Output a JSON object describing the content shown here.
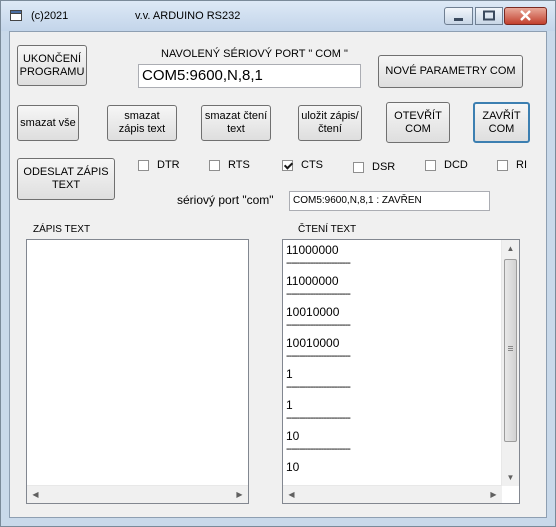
{
  "window": {
    "title_left": "(c)2021",
    "title_right": "v.v.   ARDUINO  RS232",
    "icons": {
      "app": "window-app-icon",
      "minimize": "minimize-icon",
      "maximize": "maximize-icon",
      "close": "close-icon"
    }
  },
  "buttons": {
    "end_program": "UKONČENÍ PROGRAMU",
    "new_params": "NOVÉ PARAMETRY COM",
    "clear_all": "smazat vše",
    "clear_write": "smazat zápis text",
    "clear_read": "smazat čtení text",
    "save": "uložit zápis/čtení",
    "open_com": "OTEVŘÍT COM",
    "close_com": "ZAVŘÍT COM",
    "send_text": "ODESLAT ZÁPIS TEXT"
  },
  "port_section": {
    "heading": "NAVOLENÝ SÉRIOVÝ PORT \" COM \"",
    "value": "COM5:9600,N,8,1"
  },
  "signals": [
    {
      "label": "DTR",
      "checked": false
    },
    {
      "label": "RTS",
      "checked": false
    },
    {
      "label": "CTS",
      "checked": true
    },
    {
      "label": "DSR",
      "checked": false
    },
    {
      "label": "DCD",
      "checked": false
    },
    {
      "label": "RI",
      "checked": false
    }
  ],
  "status": {
    "label": "sériový port \"com\"",
    "value": "COM5:9600,N,8,1 : ZAVŘEN"
  },
  "write_panel": {
    "label": "ZÁPIS TEXT",
    "lines": []
  },
  "read_panel": {
    "label": "ČTENÍ TEXT",
    "separator": "------------------------",
    "lines": [
      "11000000",
      "11000000",
      "10010000",
      "10010000",
      "1",
      "1",
      "10",
      "10"
    ]
  }
}
